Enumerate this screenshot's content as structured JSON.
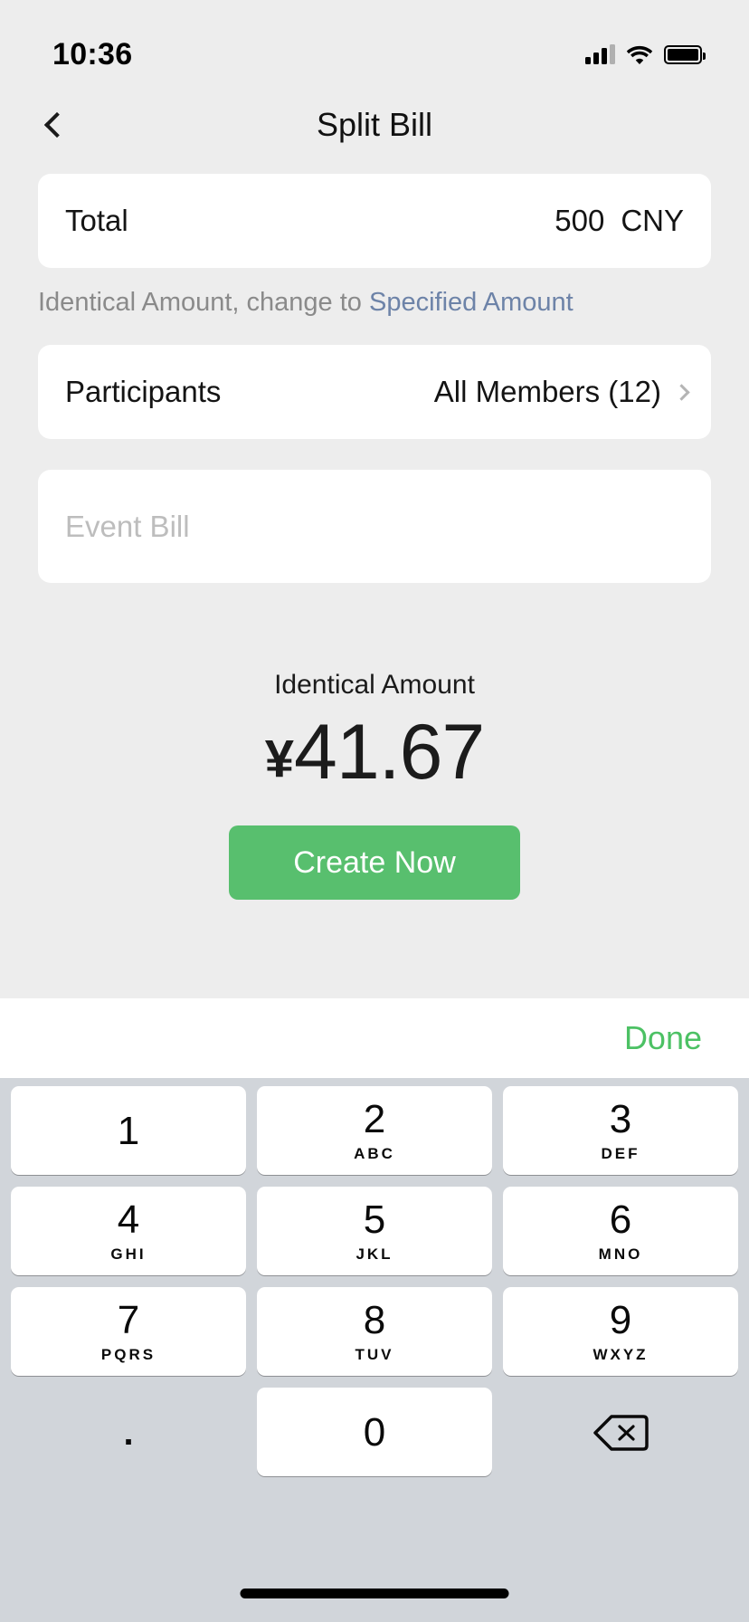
{
  "status_bar": {
    "time": "10:36",
    "signal_icon": "cellular-signal-icon",
    "wifi_icon": "wifi-icon",
    "battery_icon": "battery-icon"
  },
  "nav": {
    "back_icon": "chevron-left-icon",
    "title": "Split Bill"
  },
  "total_row": {
    "label": "Total",
    "amount": "500",
    "currency": "CNY"
  },
  "hint": {
    "prefix": "Identical Amount, change to ",
    "link": "Specified Amount",
    "link_color": "#6d83a8"
  },
  "participants_row": {
    "label": "Participants",
    "value": "All Members (12)",
    "chevron_icon": "chevron-right-icon"
  },
  "event_bill": {
    "value": "",
    "placeholder": "Event Bill"
  },
  "amount_summary": {
    "label": "Identical Amount",
    "symbol": "¥",
    "value": "41.67"
  },
  "create_button": {
    "label": "Create Now",
    "color": "#58bf6e"
  },
  "keyboard": {
    "done_label": "Done",
    "done_color": "#4cc164",
    "rows": [
      [
        {
          "digit": "1",
          "letters": ""
        },
        {
          "digit": "2",
          "letters": "ABC"
        },
        {
          "digit": "3",
          "letters": "DEF"
        }
      ],
      [
        {
          "digit": "4",
          "letters": "GHI"
        },
        {
          "digit": "5",
          "letters": "JKL"
        },
        {
          "digit": "6",
          "letters": "MNO"
        }
      ],
      [
        {
          "digit": "7",
          "letters": "PQRS"
        },
        {
          "digit": "8",
          "letters": "TUV"
        },
        {
          "digit": "9",
          "letters": "WXYZ"
        }
      ]
    ],
    "period_key": ".",
    "zero_key": "0",
    "delete_icon": "backspace-delete-icon"
  }
}
